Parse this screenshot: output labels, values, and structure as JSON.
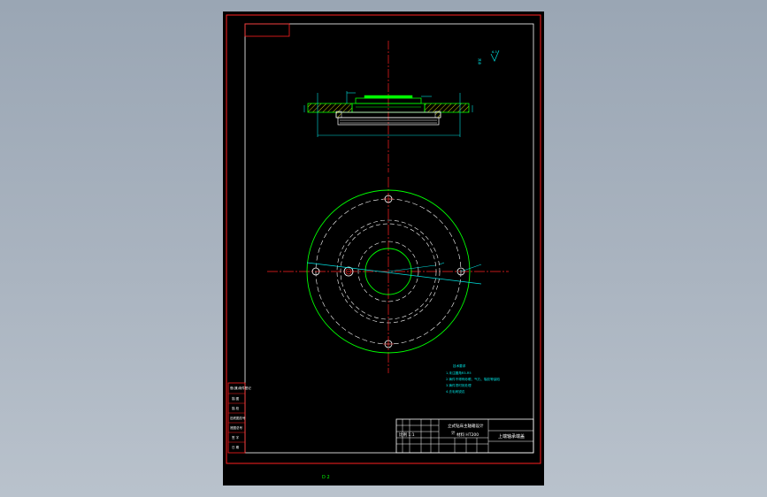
{
  "drawing": {
    "view_title": "上端轴承端盖",
    "title_block_upper": "立式钻床主轴箱设计",
    "title_block_upper_2": "计",
    "title_block_row_a": "比例 1:1",
    "title_block_row_b": "材料 HT200",
    "sheet_label": "D 2",
    "surface_mark_a": "其余",
    "surface_mark_b": "6.3"
  },
  "side_stamp": {
    "labels": [
      "借(通)用件登记",
      "描 图",
      "描 校",
      "旧底图总号",
      "底图总号",
      "签 字",
      "日 期"
    ]
  },
  "notes": {
    "heading": "技术要求",
    "lines": [
      "1.未注圆角R3-R5",
      "2.铸件不得有砂眼、气孔、裂纹等缺陷",
      "3.铸件须时效处理",
      "4.去毛刺锐边"
    ]
  },
  "colors": {
    "frame": "#ff2020",
    "green_outline": "#00ff00",
    "centerline": "#ff2020",
    "hidden": "#ffffff",
    "cyan_dim": "#00e0e0",
    "hatch": "#ffff00"
  }
}
